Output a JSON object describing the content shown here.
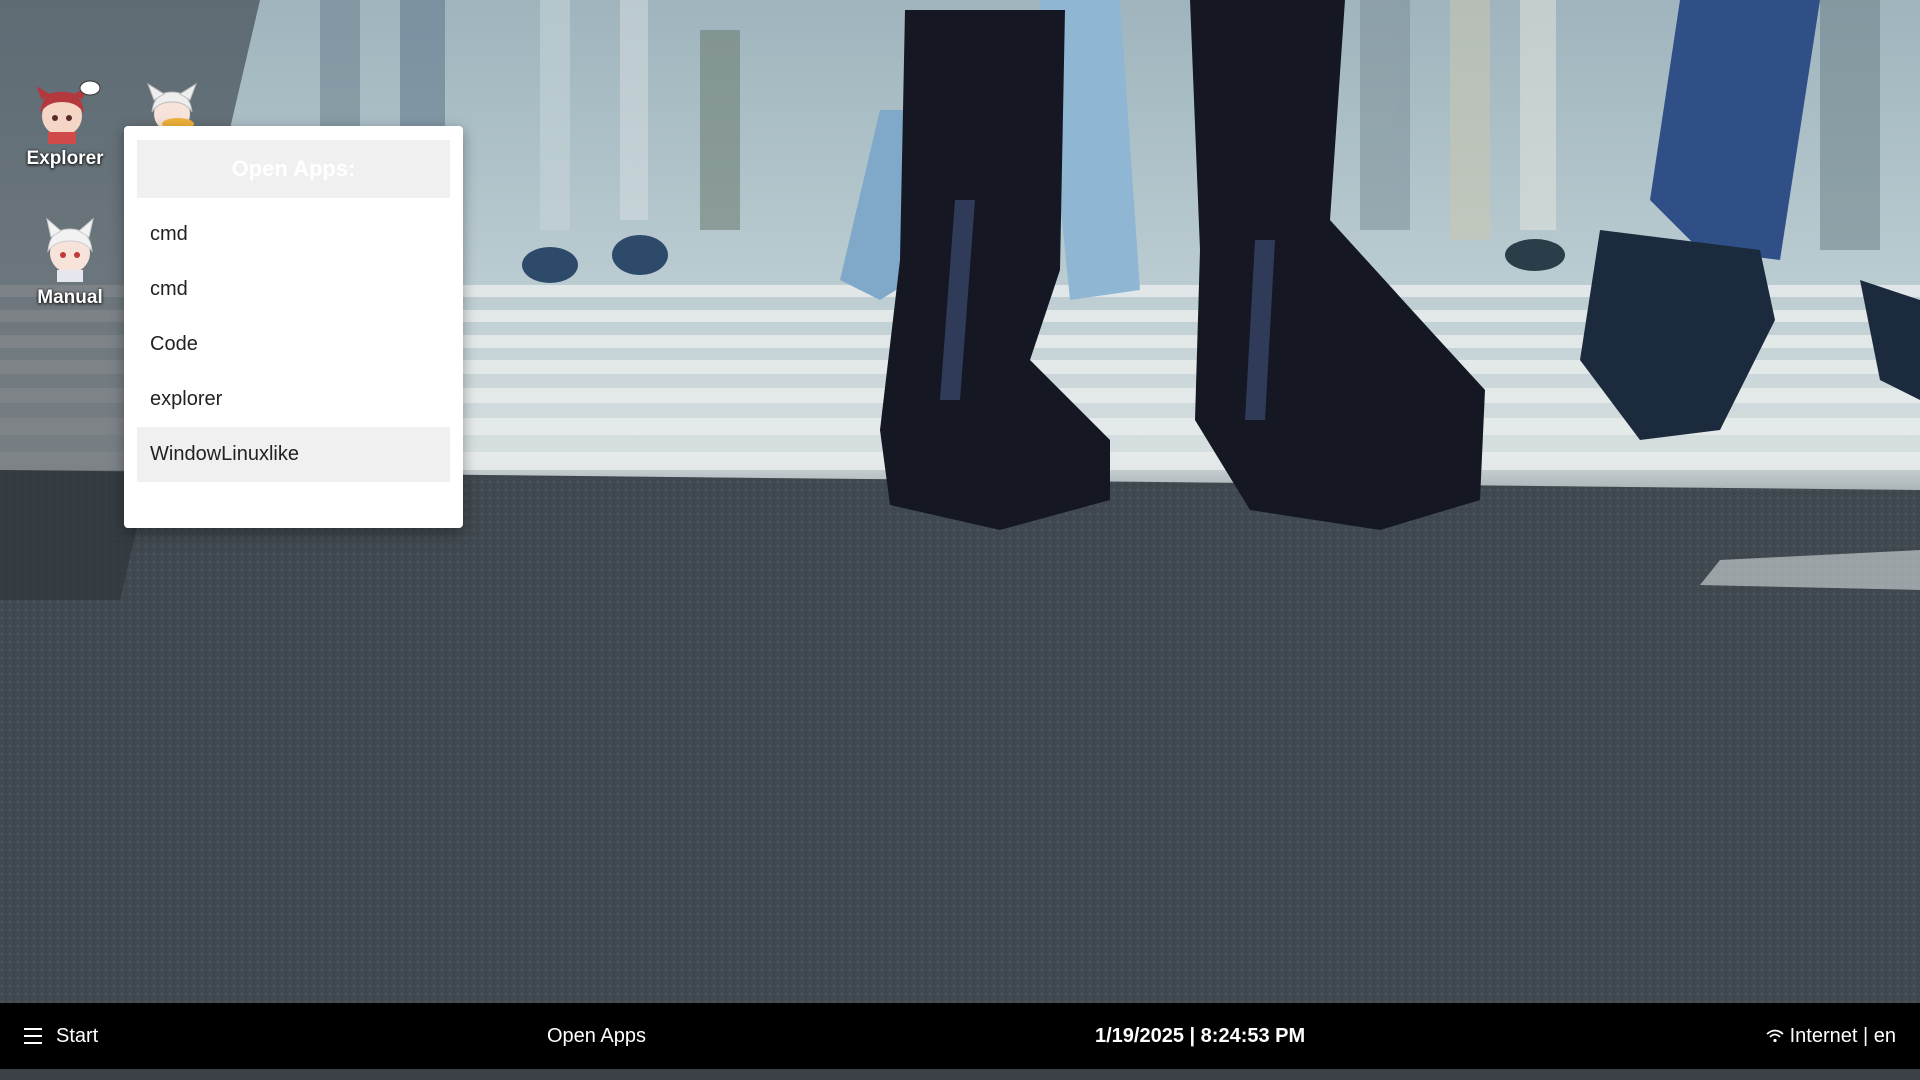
{
  "desktop": {
    "icons": [
      {
        "label": "Explorer",
        "icon": "explorer-mascot-icon"
      },
      {
        "label": "Manual",
        "icon": "manual-mascot-icon"
      },
      {
        "label": "",
        "icon": "third-mascot-icon"
      }
    ]
  },
  "apps_popup": {
    "title": "Open Apps:",
    "items": [
      {
        "label": "cmd"
      },
      {
        "label": "cmd"
      },
      {
        "label": "Code"
      },
      {
        "label": "explorer"
      },
      {
        "label": "WindowLinuxlike",
        "active": true
      }
    ]
  },
  "taskbar": {
    "start_label": "Start",
    "start_icon": "hamburger-menu-icon",
    "open_apps_label": "Open Apps",
    "datetime": "1/19/2025 | 8:24:53 PM",
    "network_icon": "wifi-icon",
    "network_label": "Internet | en"
  },
  "colors": {
    "taskbar_bg": "#000000",
    "popup_bg": "#ffffff",
    "popup_header_bg": "#f0f0f0",
    "active_item_bg": "#f0f0f0"
  }
}
